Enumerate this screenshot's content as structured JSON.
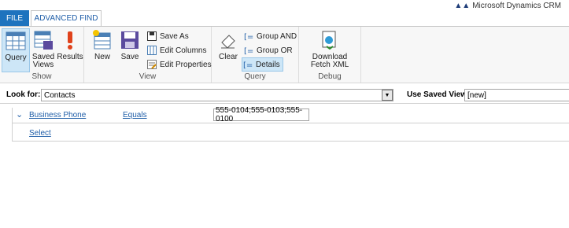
{
  "tabs": {
    "file": "FILE",
    "advanced_find": "ADVANCED FIND"
  },
  "brand": "Microsoft Dynamics CRM",
  "ribbon": {
    "show": {
      "label": "Show",
      "query": "Query",
      "saved_views": "Saved Views",
      "results": "Results"
    },
    "view": {
      "label": "View",
      "new": "New",
      "save": "Save",
      "save_as": "Save As",
      "edit_columns": "Edit Columns",
      "edit_properties": "Edit Properties"
    },
    "query": {
      "label": "Query",
      "clear": "Clear",
      "group_and": "Group AND",
      "group_or": "Group OR",
      "details": "Details"
    },
    "debug": {
      "label": "Debug",
      "download_fetch_xml": "Download Fetch XML"
    }
  },
  "look_for": {
    "label": "Look for:",
    "value": "Contacts"
  },
  "saved_view": {
    "label": "Use Saved View:",
    "value": "[new]"
  },
  "criteria": {
    "field": "Business Phone",
    "operator": "Equals",
    "value": "555-0104;555-0103;555-0100",
    "select": "Select"
  },
  "colors": {
    "accent": "#1e73be",
    "link": "#1f5ea8",
    "selected_bg": "#cde6f7"
  }
}
